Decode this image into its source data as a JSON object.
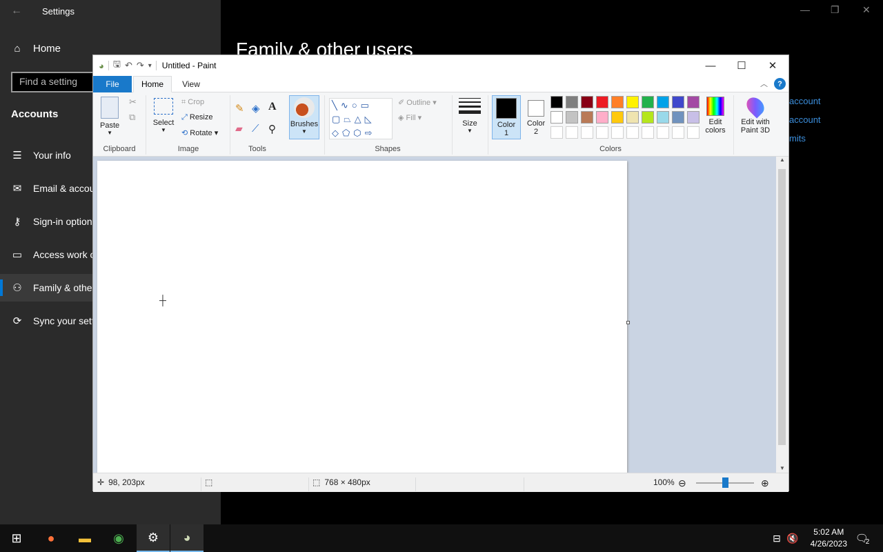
{
  "settings": {
    "title": "Settings",
    "home_label": "Home",
    "search_placeholder": "Find a setting",
    "section": "Accounts",
    "nav": [
      {
        "icon": "person-card-icon",
        "label": "Your info"
      },
      {
        "icon": "mail-icon",
        "label": "Email & accou"
      },
      {
        "icon": "key-icon",
        "label": "Sign-in option"
      },
      {
        "icon": "briefcase-icon",
        "label": "Access work o"
      },
      {
        "icon": "person-add-icon",
        "label": "Family & other"
      },
      {
        "icon": "sync-icon",
        "label": "Sync your sett"
      }
    ],
    "page_title": "Family & other users",
    "side_links": [
      "account",
      "account",
      "mits"
    ]
  },
  "paint": {
    "title": "Untitled - Paint",
    "tabs": {
      "file": "File",
      "home": "Home",
      "view": "View"
    },
    "help": "?",
    "clipboard": {
      "paste": "Paste",
      "group": "Clipboard"
    },
    "image": {
      "select": "Select",
      "crop": "Crop",
      "resize": "Resize",
      "rotate": "Rotate",
      "group": "Image"
    },
    "tools": {
      "group": "Tools",
      "text": "A"
    },
    "brushes": "Brushes",
    "shapes": {
      "outline": "Outline",
      "fill": "Fill",
      "group": "Shapes"
    },
    "size": "Size",
    "color1": {
      "l1": "Color",
      "l2": "1"
    },
    "color2": {
      "l1": "Color",
      "l2": "2"
    },
    "colors_group": "Colors",
    "edit_colors": {
      "l1": "Edit",
      "l2": "colors"
    },
    "edit_3d": {
      "l1": "Edit with",
      "l2": "Paint 3D"
    },
    "palette_row1": [
      "#000000",
      "#7f7f7f",
      "#880015",
      "#ed1c24",
      "#ff7f27",
      "#fff200",
      "#22b14c",
      "#00a2e8",
      "#3f48cc",
      "#a349a4"
    ],
    "palette_row2": [
      "#ffffff",
      "#c3c3c3",
      "#b97a57",
      "#ffaec9",
      "#ffc90e",
      "#efe4b0",
      "#b5e61d",
      "#99d9ea",
      "#7092be",
      "#c8bfe7"
    ],
    "status": {
      "pos": "98, 203px",
      "size": "768 × 480px",
      "zoom": "100%"
    }
  },
  "taskbar": {
    "time": "5:02 AM",
    "date": "4/26/2023",
    "notifications": "2"
  }
}
